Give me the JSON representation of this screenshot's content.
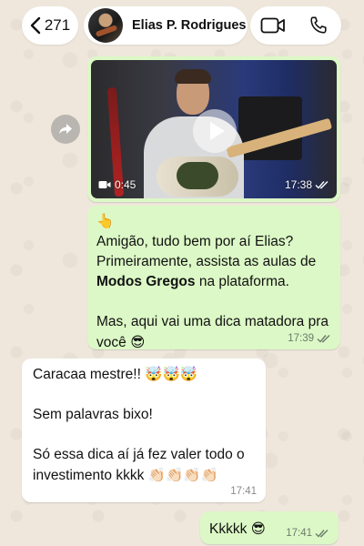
{
  "header": {
    "back_count": "271",
    "contact_name": "Elias P. Rodrigues",
    "icons": {
      "back": "chevron-left-icon",
      "video_call": "video-camera-icon",
      "voice_call": "phone-icon"
    }
  },
  "colors": {
    "outgoing_bubble": "#dcf8c6",
    "incoming_bubble": "#ffffff",
    "chat_background": "#efe7dc",
    "read_ticks": "#6b7b6b"
  },
  "video_message": {
    "duration": "0:45",
    "time": "17:38",
    "status": "read"
  },
  "messages": [
    {
      "direction": "outgoing",
      "emoji_top": "👆",
      "line1": "Amigão, tudo bem por aí Elias? Primeiramente, assista as aulas de ",
      "bold": "Modos Gregos",
      "line1_end": " na plataforma.",
      "line2": "Mas, aqui vai uma dica matadora pra você",
      "line2_emoji": "😎",
      "time": "17:39",
      "status": "read"
    },
    {
      "direction": "incoming",
      "line1": "Caracaa mestre!!",
      "line1_emoji": "🤯🤯🤯",
      "line2": "Sem palavras bixo!",
      "line3": "Só essa dica aí já fez valer todo o investimento kkkk",
      "line3_emoji": "👏🏻👏🏻👏🏻👏🏻",
      "time": "17:41"
    },
    {
      "direction": "outgoing",
      "text": "Kkkkk",
      "emoji": "😎",
      "time": "17:41",
      "status": "read"
    }
  ]
}
